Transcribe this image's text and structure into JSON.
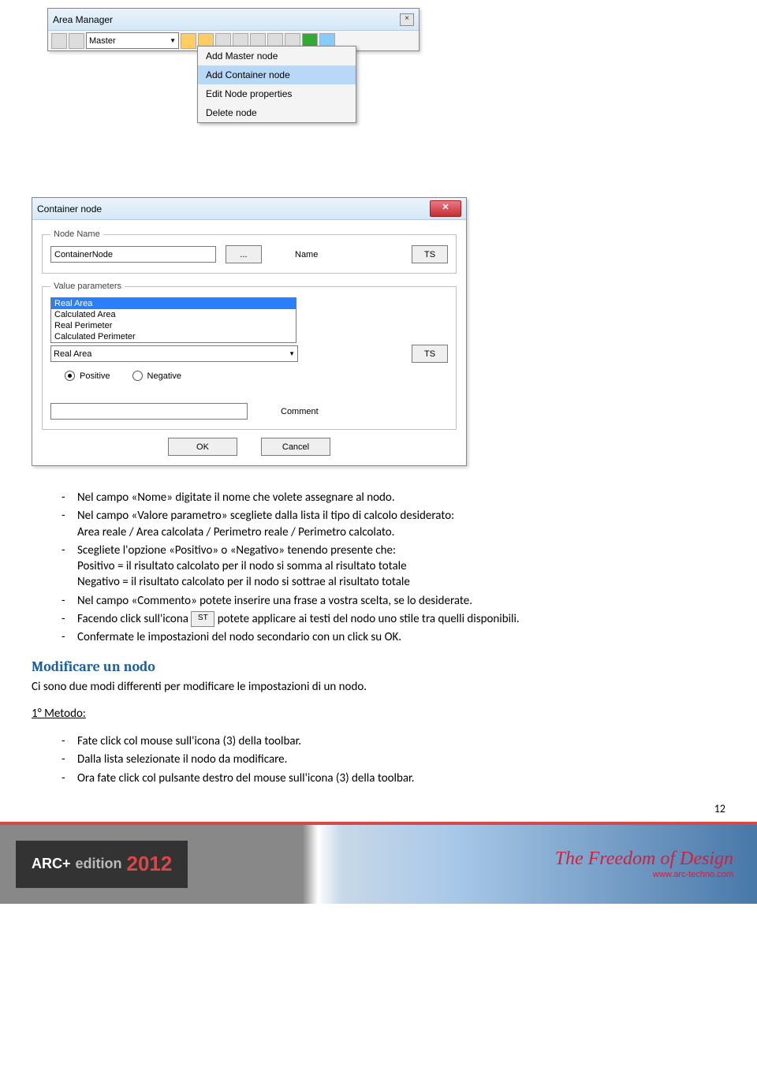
{
  "area_manager": {
    "title": "Area Manager",
    "dropdown_value": "Master",
    "menu": {
      "items": [
        "Add Master node",
        "Add Container node",
        "Edit  Node properties",
        "Delete node"
      ]
    }
  },
  "container_dialog": {
    "title": "Container node",
    "node_name_legend": "Node Name",
    "node_name_value": "ContainerNode",
    "browse_btn": "...",
    "name_label": "Name",
    "ts_btn": "TS",
    "value_params_legend": "Value parameters",
    "list_items": [
      "Real Area",
      "Calculated Area",
      "Real Perimeter",
      "Calculated Perimeter"
    ],
    "select_value": "Real Area",
    "ts_btn2": "TS",
    "positive_label": "Positive",
    "negative_label": "Negative",
    "comment_label": "Comment",
    "ok_btn": "OK",
    "cancel_btn": "Cancel"
  },
  "body_text": {
    "b1": "Nel campo «Nome» digitate il nome che volete assegnare al nodo.",
    "b2": "Nel campo «Valore parametro» scegliete dalla lista il tipo di calcolo desiderato:",
    "b2a": "Area reale / Area calcolata / Perimetro reale / Perimetro calcolato.",
    "b3": "Scegliete l'opzione «Positivo» o «Negativo» tenendo presente che:",
    "b3a": "Positivo = il risultato calcolato per il nodo si somma al risultato totale",
    "b3b": "Negativo = il risultato calcolato per il nodo si sottrae al risultato totale",
    "b4": "Nel campo «Commento» potete inserire una frase a vostra scelta, se lo desiderate.",
    "b5a": "Facendo click sull'icona ",
    "b5_icon": "ST",
    "b5b": " potete applicare ai testi del nodo uno stile tra quelli disponibili.",
    "b6": "Confermate le impostazioni del nodo secondario con un click su OK.",
    "h_modify": "Modificare un nodo",
    "p_modify": "Ci sono due modi differenti per modificare le impostazioni di un nodo.",
    "metodo1": "1° Metodo:",
    "m1a": "Fate click col mouse sull'icona (3) della toolbar.",
    "m1b": "Dalla lista selezionate il nodo da modificare.",
    "m1c": "Ora fate click col pulsante destro del mouse sull'icona (3) della toolbar."
  },
  "footer": {
    "brand_prefix": "ARC+",
    "brand_mid": "edition",
    "year": "2012",
    "tagline": "The Freedom of Design",
    "url": "www.arc-techno.com"
  },
  "page_number": "12"
}
